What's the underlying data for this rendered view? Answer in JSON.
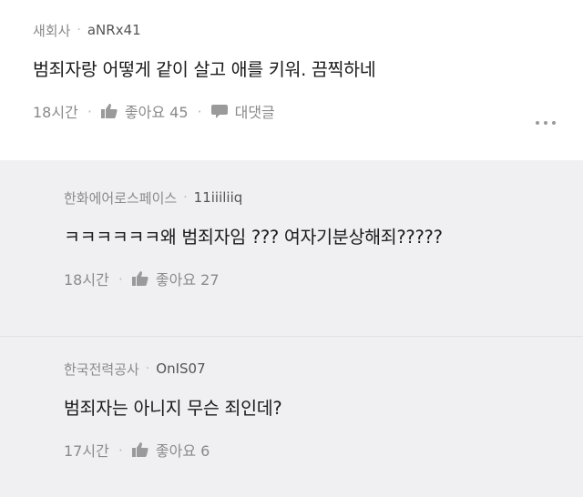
{
  "comments": [
    {
      "source": "새회사",
      "nickname": "aNRx41",
      "text": "범죄자랑 어떻게 같이 살고 애를 키워. 끔찍하네",
      "time": "18시간",
      "like_label": "좋아요 45",
      "reply_label": "대댓글"
    }
  ],
  "replies": [
    {
      "source": "한화에어로스페이스",
      "nickname": "11iiiliiq",
      "text": "ㅋㅋㅋㅋㅋㅋ왜 범죄자임 ??? 여자기분상해죄?????",
      "time": "18시간",
      "like_label": "좋아요 27"
    },
    {
      "source": "한국전력공사",
      "nickname": "OnIS07",
      "text": "범죄자는 아니지 무슨 죄인데?",
      "time": "17시간",
      "like_label": "좋아요 6"
    }
  ],
  "separator": "·",
  "icons": {
    "like": "thumbs-up-icon",
    "reply": "speech-bubble-icon",
    "more": "more-dots-icon"
  },
  "colors": {
    "reply_background": "#f0f0f2",
    "meta_text": "#8a8a8a"
  }
}
